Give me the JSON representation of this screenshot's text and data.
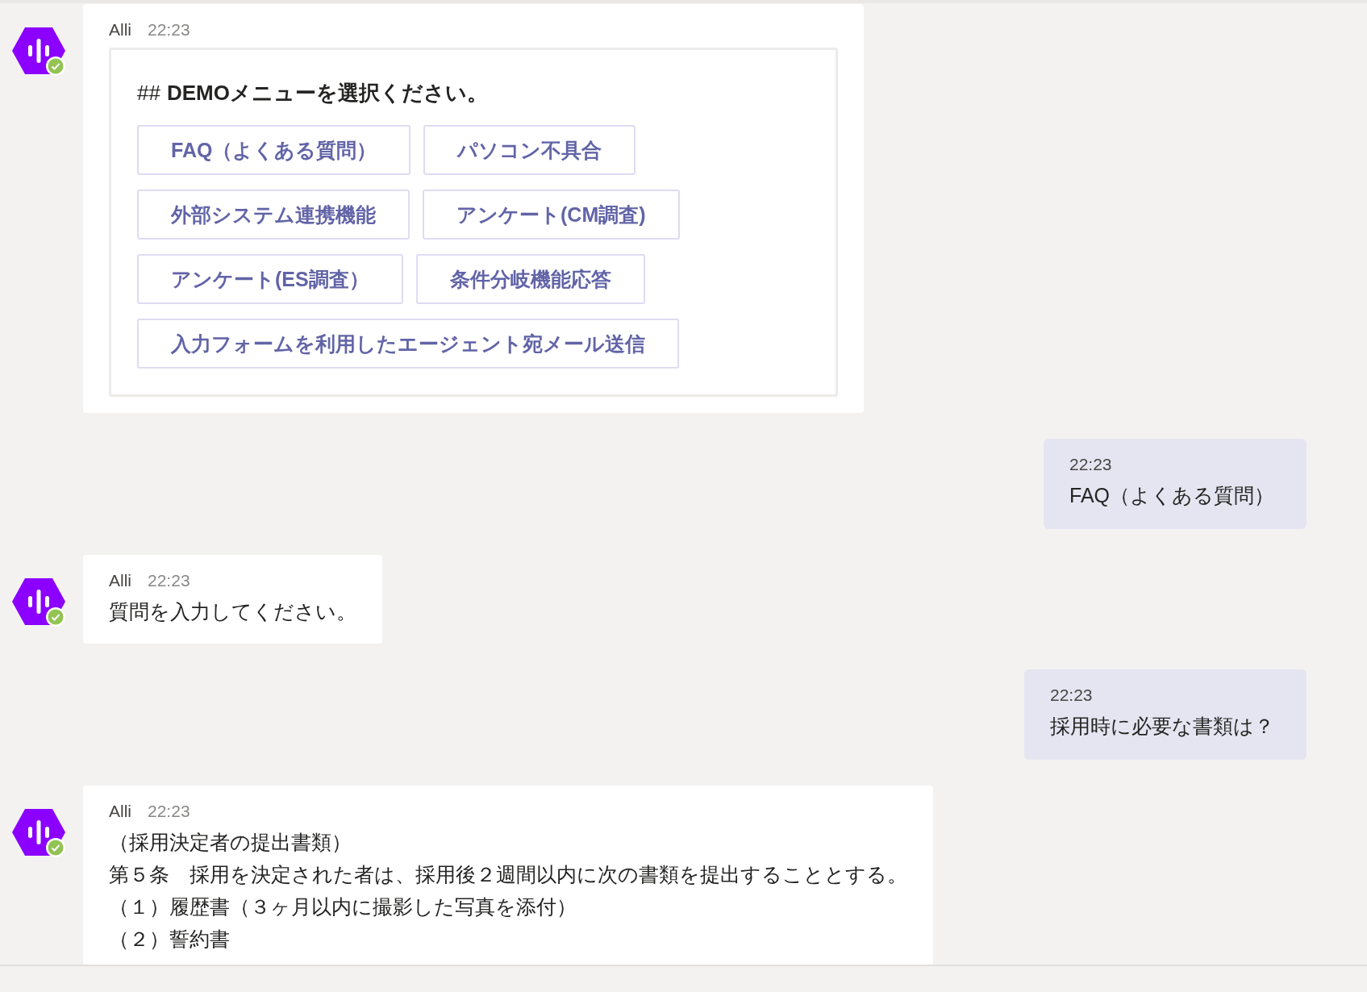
{
  "messages": [
    {
      "kind": "bot",
      "sender": "Alli",
      "time": "22:23",
      "card": {
        "heading_prefix": "##",
        "heading": "DEMOメニューを選択ください。",
        "button_rows": [
          [
            "FAQ（よくある質問）",
            "パソコン不具合"
          ],
          [
            "外部システム連携機能",
            "アンケート(CM調査)"
          ],
          [
            "アンケート(ES調査）",
            "条件分岐機能応答"
          ],
          [
            "入力フォームを利用したエージェント宛メール送信"
          ]
        ]
      }
    },
    {
      "kind": "user",
      "time": "22:23",
      "lines": [
        "FAQ（よくある質問）"
      ]
    },
    {
      "kind": "bot",
      "sender": "Alli",
      "time": "22:23",
      "lines": [
        "質問を入力してください。"
      ]
    },
    {
      "kind": "user",
      "time": "22:23",
      "lines": [
        "採用時に必要な書類は？"
      ]
    },
    {
      "kind": "bot",
      "sender": "Alli",
      "time": "22:23",
      "lines": [
        "（採用決定者の提出書類）",
        "第５条　採用を決定された者は、採用後２週間以内に次の書類を提出することとする。",
        "（１）履歴書（３ヶ月以内に撮影した写真を添付）",
        "（２）誓約書"
      ]
    }
  ]
}
